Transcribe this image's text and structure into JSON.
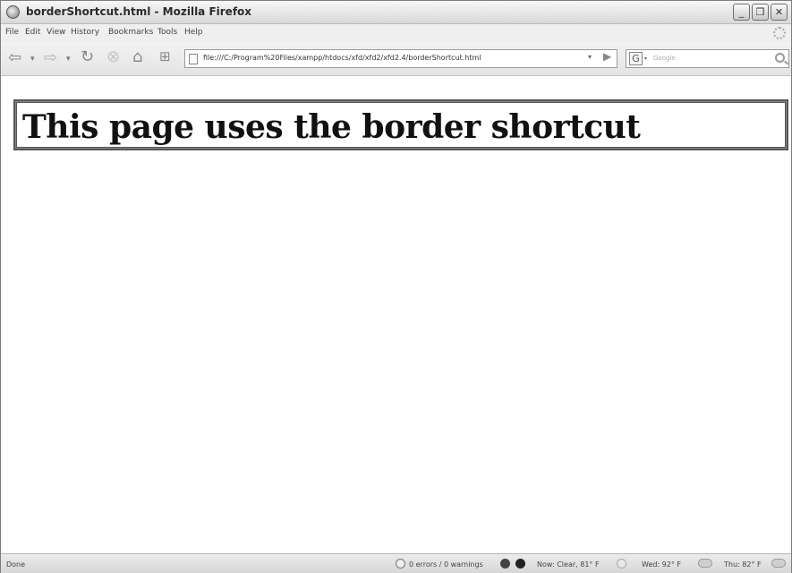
{
  "window": {
    "title": "borderShortcut.html - Mozilla Firefox"
  },
  "menu": {
    "items": [
      "File",
      "Edit",
      "View",
      "History",
      "Bookmarks",
      "Tools",
      "Help"
    ]
  },
  "navigation": {
    "url": "file:///C:/Program%20Files/xampp/htdocs/xfd/xfd2/xfd2.4/borderShortcut.html",
    "search_placeholder": "Google",
    "search_engine_glyph": "G"
  },
  "page": {
    "heading": "This page uses the border shortcut"
  },
  "status": {
    "text": "Done",
    "errors": "0 errors / 0 warnings",
    "weather_now": "Now: Clear, 81° F",
    "forecast_wed": "Wed: 92° F",
    "forecast_thu": "Thu: 82° F"
  }
}
